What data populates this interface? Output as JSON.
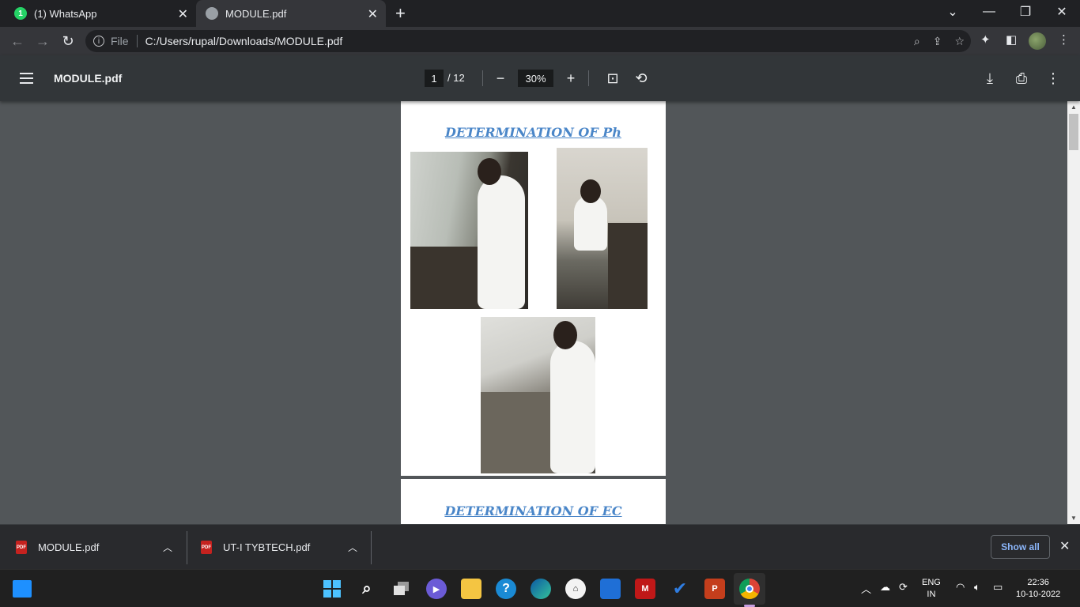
{
  "browser": {
    "tabs": [
      {
        "title": "(1) WhatsApp",
        "badge": "1",
        "active": false
      },
      {
        "title": "MODULE.pdf",
        "active": true
      }
    ],
    "address": {
      "scheme_label": "File",
      "url": "C:/Users/rupal/Downloads/MODULE.pdf"
    }
  },
  "pdf_viewer": {
    "title": "MODULE.pdf",
    "current_page": "1",
    "total_pages": "/ 12",
    "zoom": "30%"
  },
  "document": {
    "pages": [
      {
        "heading": "DETERMINATION OF Ph",
        "photo_count": 3
      },
      {
        "heading": "DETERMINATION OF EC"
      }
    ]
  },
  "downloads": {
    "items": [
      {
        "name": "MODULE.pdf",
        "icon_label": "PDF"
      },
      {
        "name": "UT-I TYBTECH.pdf",
        "icon_label": "PDF"
      }
    ],
    "show_all_label": "Show all"
  },
  "taskbar": {
    "lang_line1": "ENG",
    "lang_line2": "IN",
    "time": "22:36",
    "date": "10-10-2022",
    "pinned": [
      "start-icon",
      "search-icon",
      "task-view-icon",
      "chat-icon",
      "file-explorer-icon",
      "tips-icon",
      "edge-icon",
      "lens-icon",
      "store-icon",
      "mcafee-icon",
      "todo-icon",
      "powerpoint-icon",
      "chrome-icon"
    ]
  },
  "colors": {
    "heading": "#4a86c8",
    "viewer_bg": "#525659",
    "pdf_toolbar": "#323639",
    "accent_link": "#8ab4f8"
  }
}
